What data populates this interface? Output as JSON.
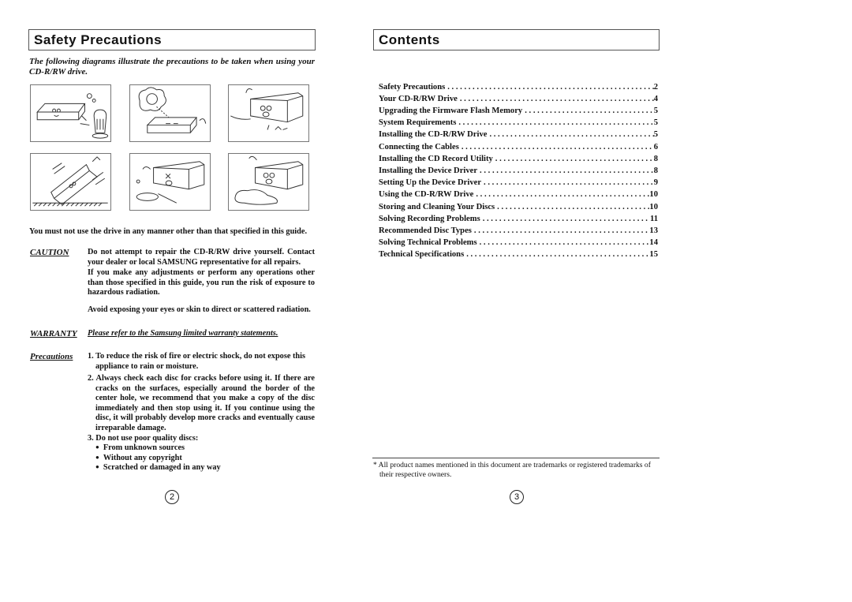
{
  "left_page": {
    "title": "Safety Precautions",
    "intro": "The following diagrams illustrate the precautions to be taken when using your CD-R/RW drive.",
    "illustrations": [
      {
        "icon": "drive-near-heater-illustration"
      },
      {
        "icon": "drive-in-sunlight-illustration"
      },
      {
        "icon": "drive-disassembly-illustration"
      },
      {
        "icon": "drive-dropped-illustration"
      },
      {
        "icon": "drive-near-water-illustration"
      },
      {
        "icon": "drive-spilled-liquid-illustration"
      }
    ],
    "warning_line": "You must not use the drive in any manner other than that specified in this guide.",
    "caution": {
      "label": "CAUTION",
      "p1": "Do not attempt to repair the CD-R/RW drive yourself. Contact your dealer or local SAMSUNG representative for all repairs.",
      "p2": "If you make any adjustments or perform any operations other than those specified in this guide, you run the risk of exposure to hazardous radiation.",
      "p3": "Avoid exposing your eyes or skin to direct or scattered radiation."
    },
    "warranty": {
      "label": "WARRANTY",
      "text": "Please refer to the Samsung limited warranty statements."
    },
    "precautions": {
      "label": "Precautions",
      "items": [
        "1. To reduce the risk of fire or electric shock, do not expose this appliance to rain or moisture.",
        "2. Always check each disc for cracks before using it. If there are cracks on the surfaces, especially around the border of the center hole, we recommend that you make a copy of the disc immediately and then stop using it. If you continue using the disc, it will probably develop more cracks and eventually cause irreparable damage.",
        "3. Do not use poor quality discs:"
      ],
      "bullets": [
        "From unknown sources",
        "Without any copyright",
        "Scratched or damaged in any way"
      ]
    },
    "page_number": "2"
  },
  "right_page": {
    "title": "Contents",
    "toc": [
      {
        "title": "Safety Precautions",
        "page": "2"
      },
      {
        "title": "Your CD-R/RW Drive",
        "page": "4"
      },
      {
        "title": "Upgrading the Firmware Flash Memory",
        "page": "5"
      },
      {
        "title": "System Requirements",
        "page": "5"
      },
      {
        "title": "Installing the CD-R/RW Drive",
        "page": "5"
      },
      {
        "title": "Connecting the Cables",
        "page": "6"
      },
      {
        "title": "Installing the CD Record Utility",
        "page": "8"
      },
      {
        "title": "Installing the Device Driver",
        "page": "8"
      },
      {
        "title": "Setting Up the Device Driver",
        "page": "9"
      },
      {
        "title": "Using the CD-R/RW Drive",
        "page": "10"
      },
      {
        "title": "Storing and Cleaning Your Discs",
        "page": "10"
      },
      {
        "title": "Solving Recording Problems",
        "page": "11"
      },
      {
        "title": "Recommended Disc Types",
        "page": "13"
      },
      {
        "title": "Solving Technical Problems",
        "page": "14"
      },
      {
        "title": "Technical Specifications",
        "page": "15"
      }
    ],
    "footnote": "* All product names mentioned in this document are trademarks or registered trademarks of their respective owners.",
    "page_number": "3"
  }
}
